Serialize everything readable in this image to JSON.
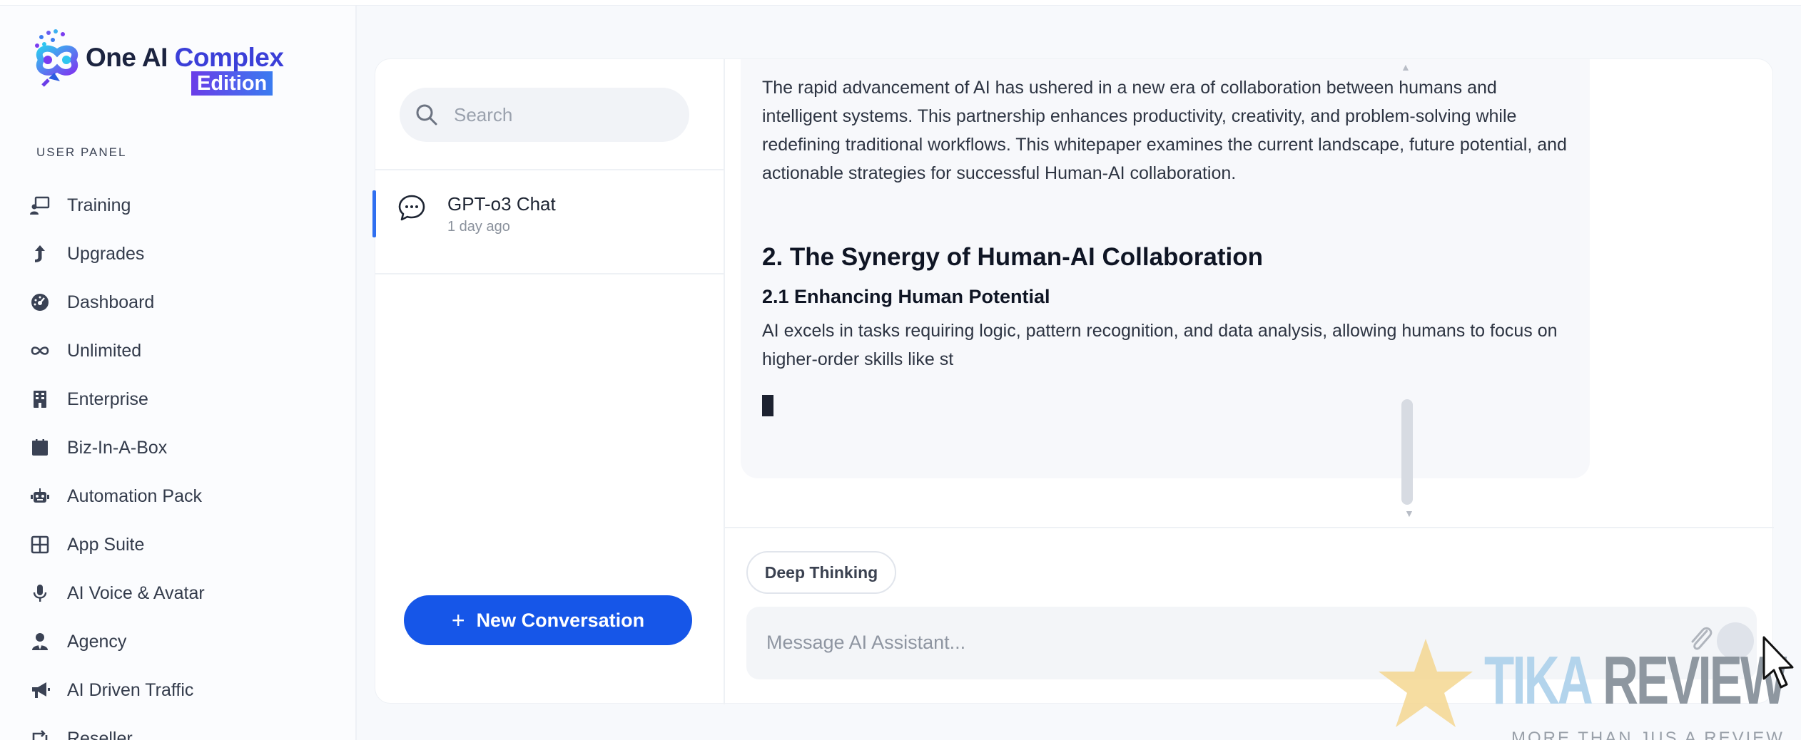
{
  "brand": {
    "name_part1": "One AI",
    "name_part2": "Complex",
    "edition": "Edition"
  },
  "sidebar": {
    "section_label": "USER PANEL",
    "items": [
      {
        "label": "Training",
        "icon": "training-icon"
      },
      {
        "label": "Upgrades",
        "icon": "upgrade-arrow-icon"
      },
      {
        "label": "Dashboard",
        "icon": "dashboard-gauge-icon"
      },
      {
        "label": "Unlimited",
        "icon": "infinity-icon"
      },
      {
        "label": "Enterprise",
        "icon": "building-icon"
      },
      {
        "label": "Biz-In-A-Box",
        "icon": "box-icon"
      },
      {
        "label": "Automation Pack",
        "icon": "robot-icon"
      },
      {
        "label": "App Suite",
        "icon": "grid-icon"
      },
      {
        "label": "AI Voice & Avatar",
        "icon": "microphone-icon"
      },
      {
        "label": "Agency",
        "icon": "user-tie-icon"
      },
      {
        "label": "AI Driven Traffic",
        "icon": "megaphone-icon"
      },
      {
        "label": "Reseller",
        "icon": "retweet-icon"
      }
    ]
  },
  "conversations": {
    "search_placeholder": "Search",
    "items": [
      {
        "title": "GPT-o3 Chat",
        "time": "1 day ago",
        "active": true
      }
    ],
    "new_button_label": "New Conversation",
    "new_button_color": "#1656e8"
  },
  "chat": {
    "message": {
      "intro": "The rapid advancement of AI has ushered in a new era of collaboration between humans and intelligent systems. This partnership enhances productivity, creativity, and problem-solving while redefining traditional workflows. This whitepaper examines the current landscape, future potential, and actionable strategies for successful Human-AI collaboration.",
      "heading": "2. The Synergy of Human-AI Collaboration",
      "subheading": "2.1 Enhancing Human Potential",
      "body": "AI excels in tasks requiring logic, pattern recognition, and data analysis, allowing humans to focus on higher-order skills like st"
    },
    "deep_thinking_label": "Deep Thinking",
    "input_placeholder": "Message AI Assistant..."
  },
  "watermark": {
    "word1": "TIKA",
    "word2": "REVIEW",
    "tagline": "MORE THAN JUS A REVIEW"
  }
}
